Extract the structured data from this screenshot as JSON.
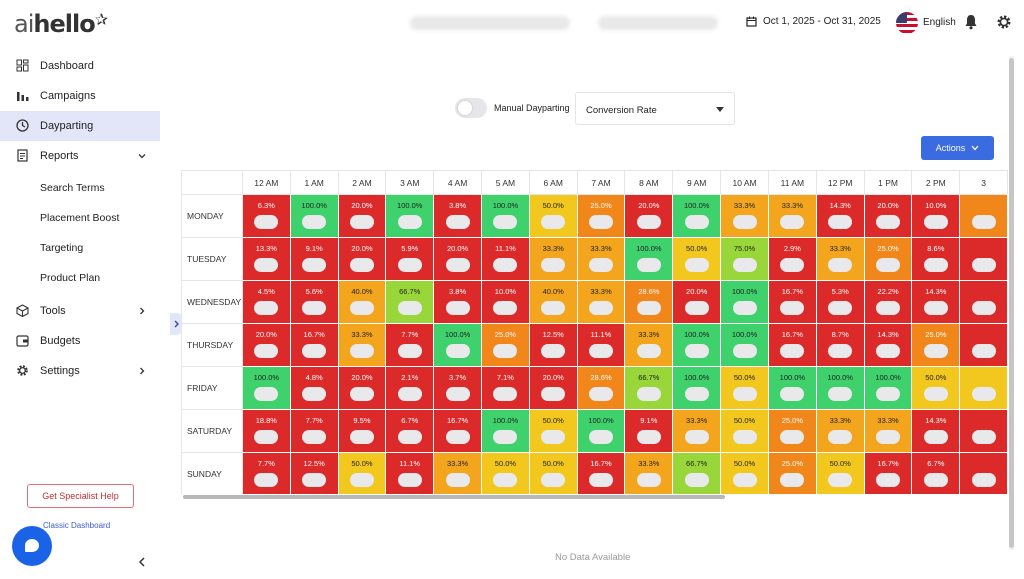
{
  "brand": {
    "logo_prefix": "ai",
    "logo_main": "hello",
    "logo_mark": "✰"
  },
  "header": {
    "date_range": "Oct 1, 2025 - Oct 31, 2025",
    "language": "English"
  },
  "sidebar": {
    "items": [
      {
        "label": "Dashboard",
        "icon": "grid-icon"
      },
      {
        "label": "Campaigns",
        "icon": "bar-chart-icon"
      },
      {
        "label": "Dayparting",
        "icon": "clock-icon",
        "active": true
      },
      {
        "label": "Reports",
        "icon": "report-icon",
        "expanded": true
      }
    ],
    "subitems": [
      "Search Terms",
      "Placement Boost",
      "Targeting",
      "Product Plan"
    ],
    "items2": [
      {
        "label": "Tools",
        "icon": "cube-icon"
      },
      {
        "label": "Budgets",
        "icon": "budget-icon"
      },
      {
        "label": "Settings",
        "icon": "gear-icon"
      }
    ],
    "specialist_label": "Get Specialist Help",
    "classic_label": "Classic Dashboard"
  },
  "toolbar": {
    "toggle_label": "Manual Dayparting",
    "metric": "Conversion Rate",
    "actions_label": "Actions"
  },
  "grid": {
    "hours": [
      "12 AM",
      "1 AM",
      "2 AM",
      "3 AM",
      "4 AM",
      "5 AM",
      "6 AM",
      "7 AM",
      "8 AM",
      "9 AM",
      "10 AM",
      "11 AM",
      "12 PM",
      "1 PM",
      "2 PM",
      "3"
    ],
    "rows": [
      {
        "day": "MONDAY",
        "cells": [
          [
            "6.3%",
            "red"
          ],
          [
            "100.0%",
            "green"
          ],
          [
            "20.0%",
            "red"
          ],
          [
            "100.0%",
            "green"
          ],
          [
            "3.8%",
            "red"
          ],
          [
            "100.0%",
            "green"
          ],
          [
            "50.0%",
            "yellow"
          ],
          [
            "25.0%",
            "orange"
          ],
          [
            "20.0%",
            "red"
          ],
          [
            "100.0%",
            "green"
          ],
          [
            "33.3%",
            "amber"
          ],
          [
            "33.3%",
            "amber"
          ],
          [
            "14.3%",
            "red"
          ],
          [
            "20.0%",
            "red"
          ],
          [
            "10.0%",
            "red"
          ],
          [
            "",
            "orange"
          ]
        ]
      },
      {
        "day": "TUESDAY",
        "cells": [
          [
            "13.3%",
            "red"
          ],
          [
            "9.1%",
            "red"
          ],
          [
            "20.0%",
            "red"
          ],
          [
            "5.9%",
            "red"
          ],
          [
            "20.0%",
            "red"
          ],
          [
            "11.1%",
            "red"
          ],
          [
            "33.3%",
            "amber"
          ],
          [
            "33.3%",
            "amber"
          ],
          [
            "100.0%",
            "green"
          ],
          [
            "50.0%",
            "yellow"
          ],
          [
            "75.0%",
            "lgreen"
          ],
          [
            "2.9%",
            "red"
          ],
          [
            "33.3%",
            "amber"
          ],
          [
            "25.0%",
            "orange"
          ],
          [
            "8.6%",
            "red"
          ],
          [
            "",
            "red"
          ]
        ]
      },
      {
        "day": "WEDNESDAY",
        "cells": [
          [
            "4.5%",
            "red"
          ],
          [
            "5.6%",
            "red"
          ],
          [
            "40.0%",
            "amber"
          ],
          [
            "66.7%",
            "lgreen"
          ],
          [
            "3.8%",
            "red"
          ],
          [
            "10.0%",
            "red"
          ],
          [
            "40.0%",
            "amber"
          ],
          [
            "33.3%",
            "amber"
          ],
          [
            "28.6%",
            "orange"
          ],
          [
            "20.0%",
            "red"
          ],
          [
            "100.0%",
            "green"
          ],
          [
            "16.7%",
            "red"
          ],
          [
            "5.3%",
            "red"
          ],
          [
            "22.2%",
            "red"
          ],
          [
            "14.3%",
            "red"
          ],
          [
            "",
            "red"
          ]
        ]
      },
      {
        "day": "THURSDAY",
        "cells": [
          [
            "20.0%",
            "red"
          ],
          [
            "16.7%",
            "red"
          ],
          [
            "33.3%",
            "amber"
          ],
          [
            "7.7%",
            "red"
          ],
          [
            "100.0%",
            "green"
          ],
          [
            "25.0%",
            "orange"
          ],
          [
            "12.5%",
            "red"
          ],
          [
            "11.1%",
            "red"
          ],
          [
            "33.3%",
            "amber"
          ],
          [
            "100.0%",
            "green"
          ],
          [
            "100.0%",
            "green"
          ],
          [
            "16.7%",
            "red"
          ],
          [
            "8.7%",
            "red"
          ],
          [
            "14.3%",
            "red"
          ],
          [
            "25.0%",
            "orange"
          ],
          [
            "",
            "red"
          ]
        ]
      },
      {
        "day": "FRIDAY",
        "cells": [
          [
            "100.0%",
            "green"
          ],
          [
            "4.8%",
            "red"
          ],
          [
            "20.0%",
            "red"
          ],
          [
            "2.1%",
            "red"
          ],
          [
            "3.7%",
            "red"
          ],
          [
            "7.1%",
            "red"
          ],
          [
            "20.0%",
            "red"
          ],
          [
            "28.6%",
            "orange"
          ],
          [
            "66.7%",
            "lgreen"
          ],
          [
            "100.0%",
            "green"
          ],
          [
            "50.0%",
            "yellow"
          ],
          [
            "100.0%",
            "green"
          ],
          [
            "100.0%",
            "green"
          ],
          [
            "100.0%",
            "green"
          ],
          [
            "50.0%",
            "yellow"
          ],
          [
            "",
            "yellow"
          ]
        ]
      },
      {
        "day": "SATURDAY",
        "cells": [
          [
            "18.8%",
            "red"
          ],
          [
            "7.7%",
            "red"
          ],
          [
            "9.5%",
            "red"
          ],
          [
            "6.7%",
            "red"
          ],
          [
            "16.7%",
            "red"
          ],
          [
            "100.0%",
            "green"
          ],
          [
            "50.0%",
            "yellow"
          ],
          [
            "100.0%",
            "green"
          ],
          [
            "9.1%",
            "red"
          ],
          [
            "33.3%",
            "amber"
          ],
          [
            "50.0%",
            "yellow"
          ],
          [
            "25.0%",
            "orange"
          ],
          [
            "33.3%",
            "amber"
          ],
          [
            "33.3%",
            "amber"
          ],
          [
            "14.3%",
            "red"
          ],
          [
            "",
            "red"
          ]
        ]
      },
      {
        "day": "SUNDAY",
        "cells": [
          [
            "7.7%",
            "red"
          ],
          [
            "12.5%",
            "red"
          ],
          [
            "50.0%",
            "yellow"
          ],
          [
            "11.1%",
            "red"
          ],
          [
            "33.3%",
            "amber"
          ],
          [
            "50.0%",
            "yellow"
          ],
          [
            "50.0%",
            "yellow"
          ],
          [
            "16.7%",
            "red"
          ],
          [
            "33.3%",
            "amber"
          ],
          [
            "66.7%",
            "lgreen"
          ],
          [
            "50.0%",
            "yellow"
          ],
          [
            "25.0%",
            "orange"
          ],
          [
            "50.0%",
            "yellow"
          ],
          [
            "16.7%",
            "red"
          ],
          [
            "6.7%",
            "red"
          ],
          [
            "",
            "red"
          ]
        ]
      }
    ]
  },
  "empty_state": "No Data Available"
}
